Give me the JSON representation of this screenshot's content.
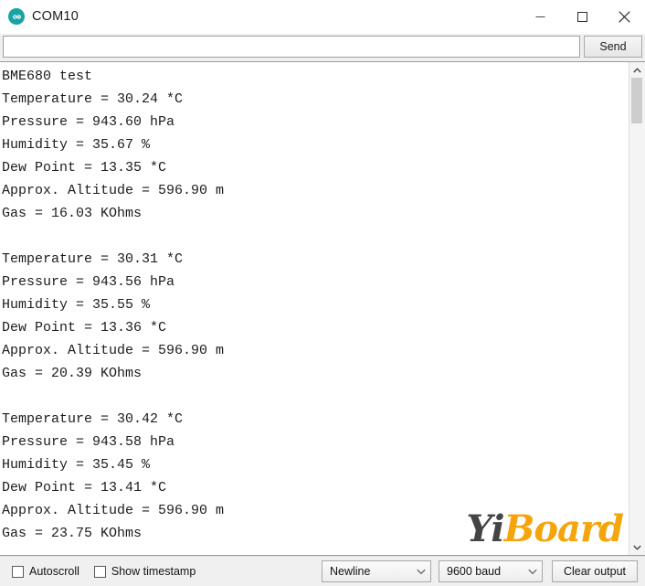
{
  "window": {
    "title": "COM10",
    "icon": "arduino-icon",
    "minimize_label": "Minimize",
    "maximize_label": "Maximize",
    "close_label": "Close"
  },
  "send_row": {
    "input_value": "",
    "input_placeholder": "",
    "send_label": "Send"
  },
  "console": {
    "lines": [
      "BME680 test",
      "Temperature = 30.24 *C",
      "Pressure = 943.60 hPa",
      "Humidity = 35.67 %",
      "Dew Point = 13.35 *C",
      "Approx. Altitude = 596.90 m",
      "Gas = 16.03 KOhms",
      "",
      "Temperature = 30.31 *C",
      "Pressure = 943.56 hPa",
      "Humidity = 35.55 %",
      "Dew Point = 13.36 *C",
      "Approx. Altitude = 596.90 m",
      "Gas = 20.39 KOhms",
      "",
      "Temperature = 30.42 *C",
      "Pressure = 943.58 hPa",
      "Humidity = 35.45 %",
      "Dew Point = 13.41 *C",
      "Approx. Altitude = 596.90 m",
      "Gas = 23.75 KOhms"
    ],
    "readings": [
      {
        "temperature_c": 30.24,
        "pressure_hpa": 943.6,
        "humidity_pct": 35.67,
        "dew_point_c": 13.35,
        "altitude_m": 596.9,
        "gas_kohms": 16.03
      },
      {
        "temperature_c": 30.31,
        "pressure_hpa": 943.56,
        "humidity_pct": 35.55,
        "dew_point_c": 13.36,
        "altitude_m": 596.9,
        "gas_kohms": 20.39
      },
      {
        "temperature_c": 30.42,
        "pressure_hpa": 943.58,
        "humidity_pct": 35.45,
        "dew_point_c": 13.41,
        "altitude_m": 596.9,
        "gas_kohms": 23.75
      }
    ]
  },
  "scrollbar": {
    "up_arrow": "chevron-up-icon",
    "down_arrow": "chevron-down-icon"
  },
  "watermark": {
    "text_dark": "Yi",
    "text_accent": "Board",
    "color_dark": "#3a3a3a",
    "color_accent": "#f5a100"
  },
  "bottom_bar": {
    "autoscroll_label": "Autoscroll",
    "autoscroll_checked": false,
    "timestamp_label": "Show timestamp",
    "timestamp_checked": false,
    "line_ending_value": "Newline",
    "baud_value": "9600 baud",
    "clear_label": "Clear output"
  }
}
